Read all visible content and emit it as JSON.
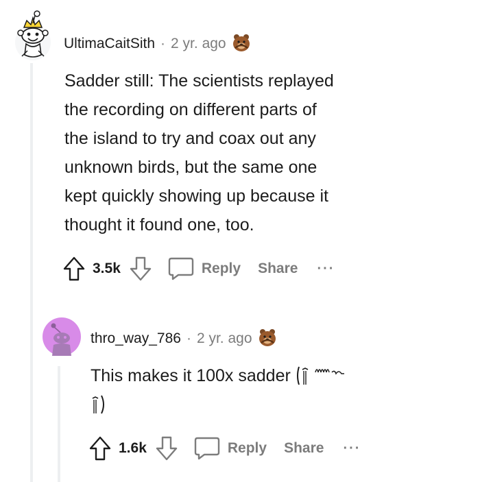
{
  "comments": [
    {
      "username": "UltimaCaitSith",
      "separator": "·",
      "time": "2 yr. ago",
      "body_lines": [
        "Sadder still: The scientists replayed",
        "the recording on different parts of",
        "the island to try and coax out any",
        "unknown birds, but the same one",
        "kept quickly showing up because it",
        "thought it found one, too."
      ],
      "score": "3.5k",
      "reply_label": "Reply",
      "share_label": "Share",
      "more_label": "···"
    },
    {
      "username": "thro_way_786",
      "separator": "·",
      "time": "2 yr. ago",
      "body_line1": "This makes it 100x sadder",
      "score": "1.6k",
      "reply_label": "Reply",
      "share_label": "Share",
      "more_label": "···"
    }
  ],
  "colors": {
    "text": "#1c1c1c",
    "muted": "#7c7c7c",
    "thread_line": "#edeff1",
    "avatar2_bg": "#d88be8"
  },
  "icons": [
    "snoo-avatar-icon",
    "award-bear-icon",
    "upvote-icon",
    "downvote-icon",
    "comment-bubble-icon"
  ]
}
